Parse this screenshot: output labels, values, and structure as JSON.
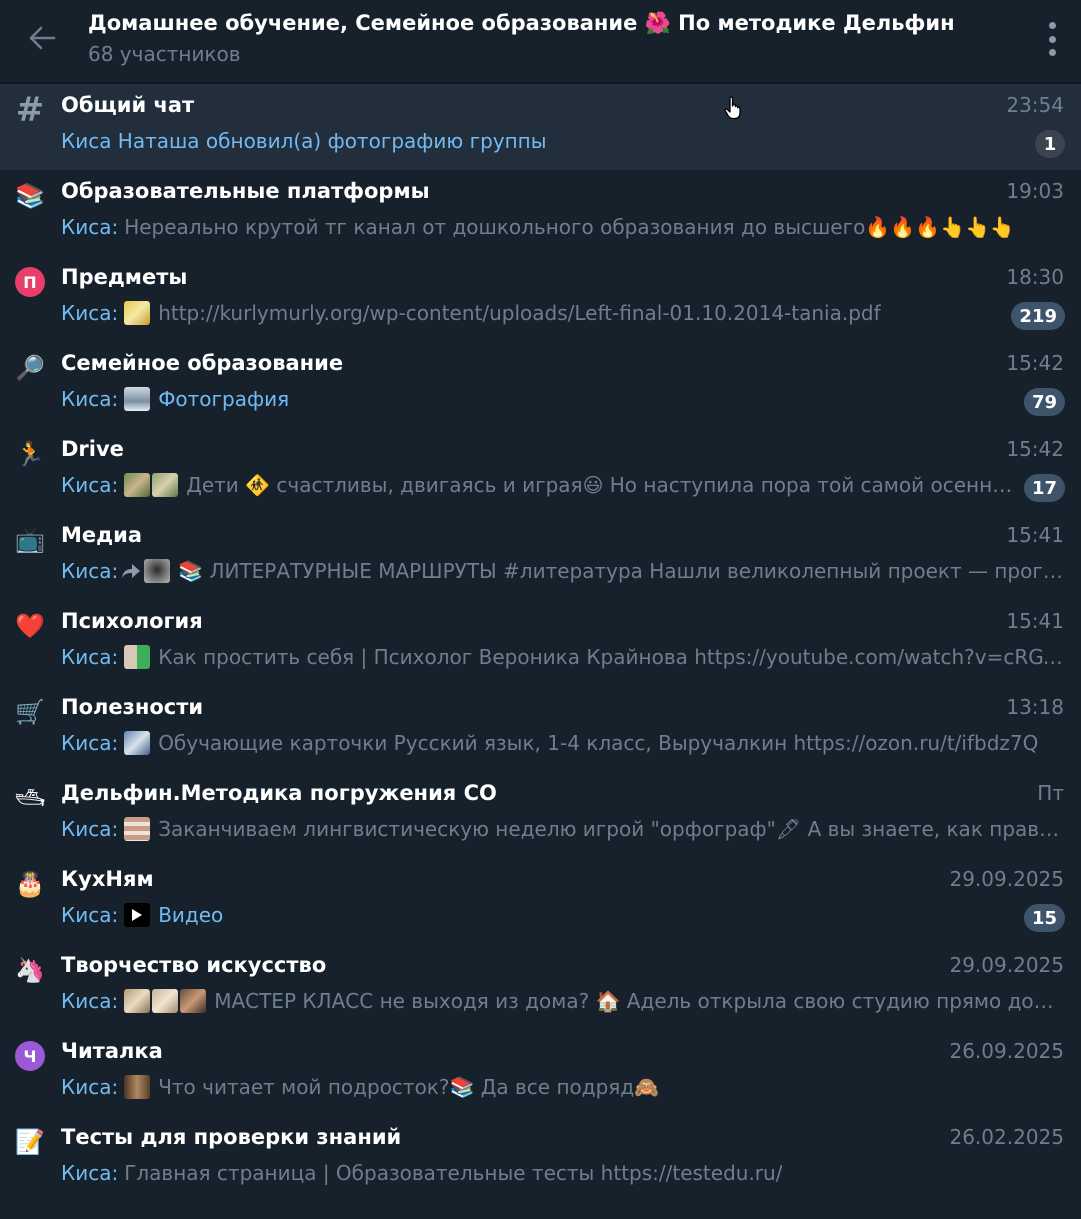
{
  "header": {
    "title": "Домашнее обучение, Семейное образование 🌺 По методике Дельфин",
    "subtitle": "68 участников"
  },
  "chats": [
    {
      "name": "Общий чат",
      "time": "23:54",
      "sender": "Киса Наташа обновил(а) фотографию группы",
      "text": "",
      "badge": "1",
      "icon": "hash-icon"
    },
    {
      "name": "Образовательные платформы",
      "time": "19:03",
      "sender": "Киса:",
      "text": "Нереально крутой тг канал от дошкольного образования до высшего🔥🔥🔥👆👆👆",
      "badge": "",
      "icon": "books-icon",
      "emoji": "📚"
    },
    {
      "name": "Предметы",
      "time": "18:30",
      "sender": "Киса:",
      "text": "http://kurlymurly.org/wp-content/uploads/Left-final-01.10.2014-tania.pdf",
      "badge": "219",
      "icon": "letter-avatar-icon",
      "letter": "П"
    },
    {
      "name": "Семейное образование",
      "time": "15:42",
      "sender": "Киса:",
      "text": "Фотография",
      "badge": "79",
      "icon": "magnifier-icon",
      "emoji": "🔎"
    },
    {
      "name": "Drive",
      "time": "15:42",
      "sender": "Киса:",
      "text": "Дети 🚸 счастливы, двигаясь и играя😃  Но наступила пора той самой осенне...",
      "badge": "17",
      "icon": "runner-icon",
      "emoji": "🏃"
    },
    {
      "name": "Медиа",
      "time": "15:41",
      "sender": "Киса:",
      "text": "📚 ЛИТЕРАТУРНЫЕ МАРШРУТЫ #литература  Нашли великолепный проект — прогр...",
      "badge": "",
      "icon": "tv-icon",
      "emoji": "📺"
    },
    {
      "name": "Психология",
      "time": "15:41",
      "sender": "Киса:",
      "text": "Как простить себя | Психолог Вероника Крайнова https://youtube.com/watch?v=cRGY6...",
      "badge": "",
      "icon": "heart-icon",
      "emoji": "❤️"
    },
    {
      "name": "Полезности",
      "time": "13:18",
      "sender": "Киса:",
      "text": "Обучающие карточки Русский язык, 1-4 класс, Выручалкин https://ozon.ru/t/ifbdz7Q",
      "badge": "",
      "icon": "cart-icon",
      "emoji": "🛒"
    },
    {
      "name": "Дельфин.Методика погружения СО",
      "time": "Пт",
      "sender": "Киса:",
      "text": "Заканчиваем лингвистическую неделю игрой \"орфограф\"🖋  А вы знаете, как правил...",
      "badge": "",
      "icon": "ship-icon",
      "emoji": "🛥"
    },
    {
      "name": "КухНям",
      "time": "29.09.2025",
      "sender": "Киса:",
      "text": "Видео",
      "badge": "15",
      "icon": "cake-icon",
      "emoji": "🎂"
    },
    {
      "name": "Творчество искусство",
      "time": "29.09.2025",
      "sender": "Киса:",
      "text": "МАСТЕР  КЛАСС не выходя из дома? 🏠  Адель открыла свою студию прямо дома...",
      "badge": "",
      "icon": "unicorn-icon",
      "emoji": "🦄"
    },
    {
      "name": "Читалка",
      "time": "26.09.2025",
      "sender": "Киса:",
      "text": "Что читает мой  подросток?📚  Да все подряд🙈",
      "badge": "",
      "icon": "letter-avatar-icon",
      "letter": "Ч"
    },
    {
      "name": "Тесты для проверки знаний",
      "time": "26.02.2025",
      "sender": "Киса:",
      "text": "Главная страница | Образовательные тесты https://testedu.ru/",
      "badge": "",
      "icon": "memo-icon",
      "emoji": "📝"
    }
  ],
  "colors": {
    "background": "#17212b",
    "selected": "#232e3c",
    "accent": "#71baf2",
    "muted": "#6d7f8f",
    "badge": "#3e546a",
    "avatar_p": "#e83e6a",
    "avatar_ch": "#9b59d6"
  }
}
